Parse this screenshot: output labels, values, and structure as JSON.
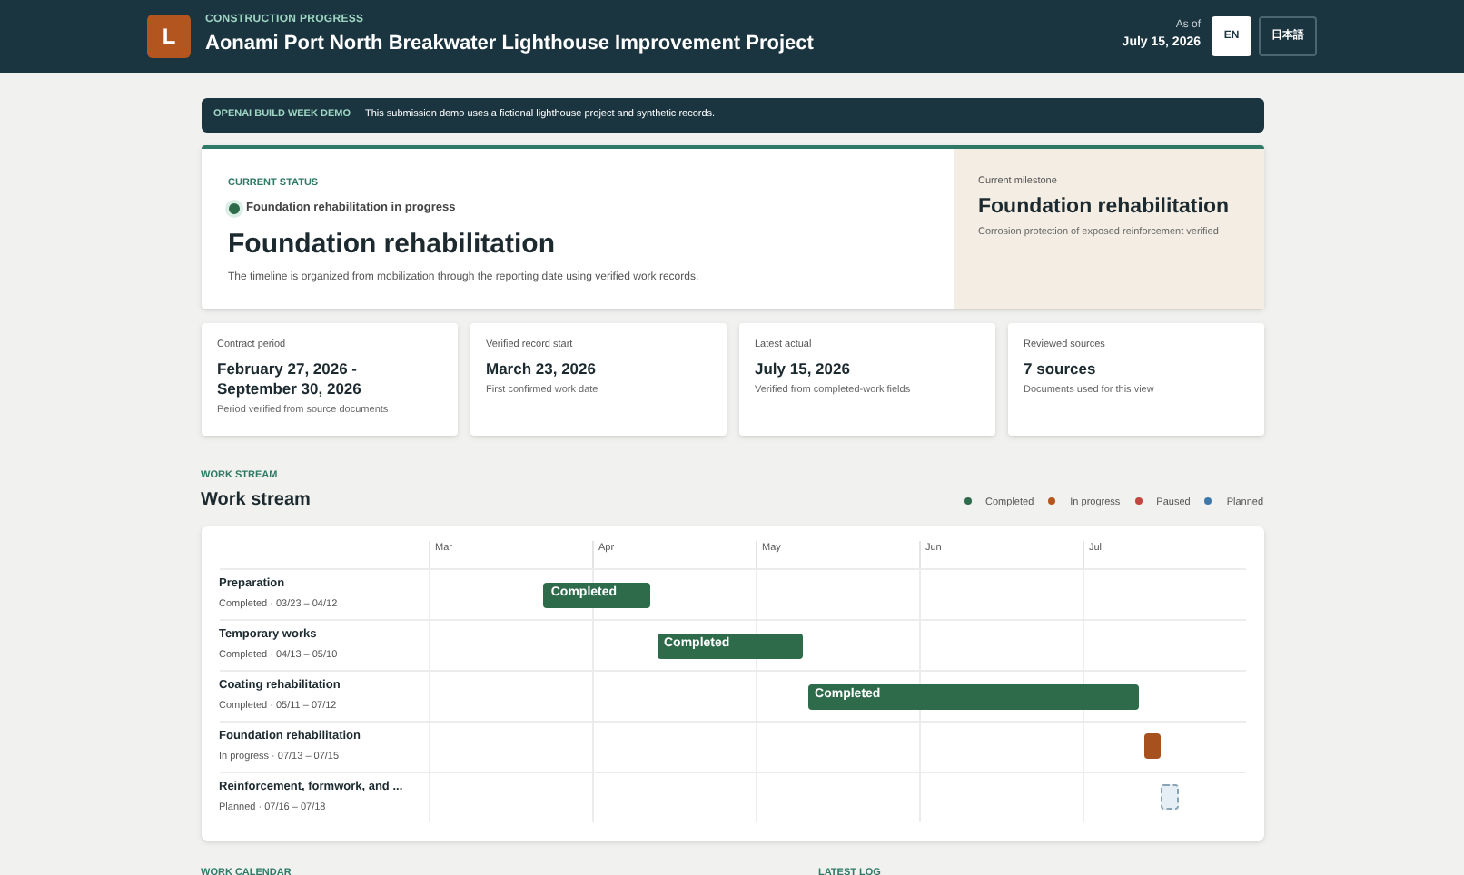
{
  "header": {
    "logo_letter": "L",
    "eyebrow": "CONSTRUCTION PROGRESS",
    "title": "Aonami Port North Breakwater Lighthouse Improvement Project",
    "as_of_label": "As of",
    "as_of_date": "July 15, 2026",
    "languages": [
      {
        "label": "EN",
        "selected": true
      },
      {
        "label": "日本語",
        "selected": false
      }
    ]
  },
  "banner": {
    "tag": "OPENAI BUILD WEEK DEMO",
    "text": "This submission demo uses a fictional lighthouse project and synthetic records."
  },
  "status": {
    "eyebrow": "CURRENT STATUS",
    "pill": "Foundation rehabilitation in progress",
    "heading": "Foundation rehabilitation",
    "description": "The timeline is organized from mobilization through the reporting date using verified work records."
  },
  "milestone": {
    "label": "Current milestone",
    "title": "Foundation rehabilitation",
    "note": "Corrosion protection of exposed reinforcement verified"
  },
  "stats": [
    {
      "label": "Contract period",
      "value": "February 27, 2026 - September 30, 2026",
      "note": "Period verified from source documents"
    },
    {
      "label": "Verified record start",
      "value": "March 23, 2026",
      "note": "First confirmed work date"
    },
    {
      "label": "Latest actual",
      "value": "July 15, 2026",
      "note": "Verified from completed-work fields"
    },
    {
      "label": "Reviewed sources",
      "value": "7 sources",
      "note": "Documents used for this view"
    }
  ],
  "work_stream": {
    "eyebrow": "WORK STREAM",
    "title": "Work stream",
    "legend": [
      {
        "label": "Completed",
        "color": "#2e6b4b"
      },
      {
        "label": "In progress",
        "color": "#b5561f"
      },
      {
        "label": "Paused",
        "color": "#c0463f"
      },
      {
        "label": "Planned",
        "color": "#3f78a8"
      }
    ],
    "months": [
      "Mar",
      "Apr",
      "May",
      "Jun",
      "Jul"
    ],
    "rows": [
      {
        "name": "Preparation",
        "kind": "completed",
        "sub": "Completed · 03/23 – 04/12",
        "bar_label": "Completed"
      },
      {
        "name": "Temporary works",
        "kind": "completed",
        "sub": "Completed · 04/13 – 05/10",
        "bar_label": "Completed"
      },
      {
        "name": "Coating rehabilitation",
        "kind": "completed",
        "sub": "Completed · 05/11 – 07/12",
        "bar_label": "Completed"
      },
      {
        "name": "Foundation rehabilitation",
        "kind": "progress",
        "sub": "In progress · 07/13 – 07/15"
      },
      {
        "name": "Reinforcement, formwork, and ...",
        "kind": "planned",
        "sub": "Planned · 07/16 – 07/18"
      }
    ]
  },
  "footer_sections": [
    "WORK CALENDAR",
    "LATEST LOG"
  ]
}
